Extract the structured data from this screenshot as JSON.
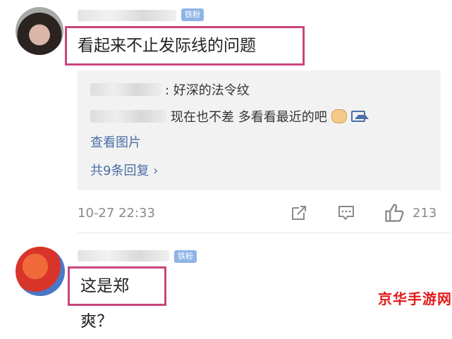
{
  "comments": [
    {
      "badge": "铁粉",
      "text": "看起来不止发际线的问题",
      "replies": [
        {
          "text": ": 好深的法令纹"
        },
        {
          "text": "现在也不差 多看看最近的吧"
        }
      ],
      "view_images": "查看图片",
      "replies_count": "共9条回复 ›",
      "timestamp": "10-27 22:33",
      "likes": "213",
      "icons": [
        "share-icon",
        "comment-icon",
        "like-icon",
        "cat-emoji-icon",
        "image-icon"
      ]
    },
    {
      "badge": "铁粉",
      "text": "这是郑爽？"
    }
  ],
  "watermark": "京华手游网",
  "colors": {
    "link": "#4a6fa5",
    "badge": "#8fb4e6",
    "highlight_border": "#c9467c",
    "watermark": "#e11a1a"
  }
}
